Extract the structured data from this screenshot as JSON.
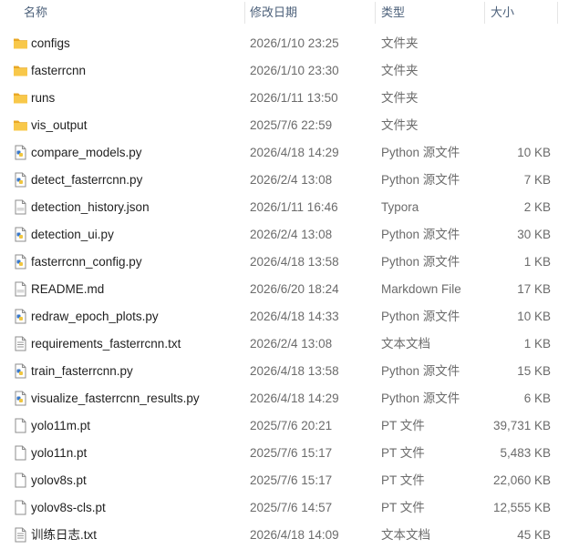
{
  "columns": {
    "name": "名称",
    "date": "修改日期",
    "type": "类型",
    "size": "大小"
  },
  "files": [
    {
      "icon": "folder-icon",
      "name": "configs",
      "date": "2026/1/10 23:25",
      "type": "文件夹",
      "size": ""
    },
    {
      "icon": "folder-icon",
      "name": "fasterrcnn",
      "date": "2026/1/10 23:30",
      "type": "文件夹",
      "size": ""
    },
    {
      "icon": "folder-icon",
      "name": "runs",
      "date": "2026/1/11 13:50",
      "type": "文件夹",
      "size": ""
    },
    {
      "icon": "folder-icon",
      "name": "vis_output",
      "date": "2025/7/6 22:59",
      "type": "文件夹",
      "size": ""
    },
    {
      "icon": "python-file-icon",
      "name": "compare_models.py",
      "date": "2026/4/18 14:29",
      "type": "Python 源文件",
      "size": "10 KB"
    },
    {
      "icon": "python-file-icon",
      "name": "detect_fasterrcnn.py",
      "date": "2026/2/4 13:08",
      "type": "Python 源文件",
      "size": "7 KB"
    },
    {
      "icon": "markdown-file-icon",
      "name": "detection_history.json",
      "date": "2026/1/11 16:46",
      "type": "Typora",
      "size": "2 KB"
    },
    {
      "icon": "python-file-icon",
      "name": "detection_ui.py",
      "date": "2026/2/4 13:08",
      "type": "Python 源文件",
      "size": "30 KB"
    },
    {
      "icon": "python-file-icon",
      "name": "fasterrcnn_config.py",
      "date": "2026/4/18 13:58",
      "type": "Python 源文件",
      "size": "1 KB"
    },
    {
      "icon": "markdown-file-icon",
      "name": "README.md",
      "date": "2026/6/20 18:24",
      "type": "Markdown File",
      "size": "17 KB"
    },
    {
      "icon": "python-file-icon",
      "name": "redraw_epoch_plots.py",
      "date": "2026/4/18 14:33",
      "type": "Python 源文件",
      "size": "10 KB"
    },
    {
      "icon": "text-file-icon",
      "name": "requirements_fasterrcnn.txt",
      "date": "2026/2/4 13:08",
      "type": "文本文档",
      "size": "1 KB"
    },
    {
      "icon": "python-file-icon",
      "name": "train_fasterrcnn.py",
      "date": "2026/4/18 13:58",
      "type": "Python 源文件",
      "size": "15 KB"
    },
    {
      "icon": "python-file-icon",
      "name": "visualize_fasterrcnn_results.py",
      "date": "2026/4/18 14:29",
      "type": "Python 源文件",
      "size": "6 KB"
    },
    {
      "icon": "file-icon",
      "name": "yolo11m.pt",
      "date": "2025/7/6 20:21",
      "type": "PT 文件",
      "size": "39,731 KB"
    },
    {
      "icon": "file-icon",
      "name": "yolo11n.pt",
      "date": "2025/7/6 15:17",
      "type": "PT 文件",
      "size": "5,483 KB"
    },
    {
      "icon": "file-icon",
      "name": "yolov8s.pt",
      "date": "2025/7/6 15:17",
      "type": "PT 文件",
      "size": "22,060 KB"
    },
    {
      "icon": "file-icon",
      "name": "yolov8s-cls.pt",
      "date": "2025/7/6 14:57",
      "type": "PT 文件",
      "size": "12,555 KB"
    },
    {
      "icon": "text-file-icon",
      "name": "训练日志.txt",
      "date": "2026/4/18 14:09",
      "type": "文本文档",
      "size": "45 KB"
    }
  ],
  "colors": {
    "header_text": "#4c607a",
    "folder": "#f8c84a",
    "python_accent": "#3a78c9"
  }
}
